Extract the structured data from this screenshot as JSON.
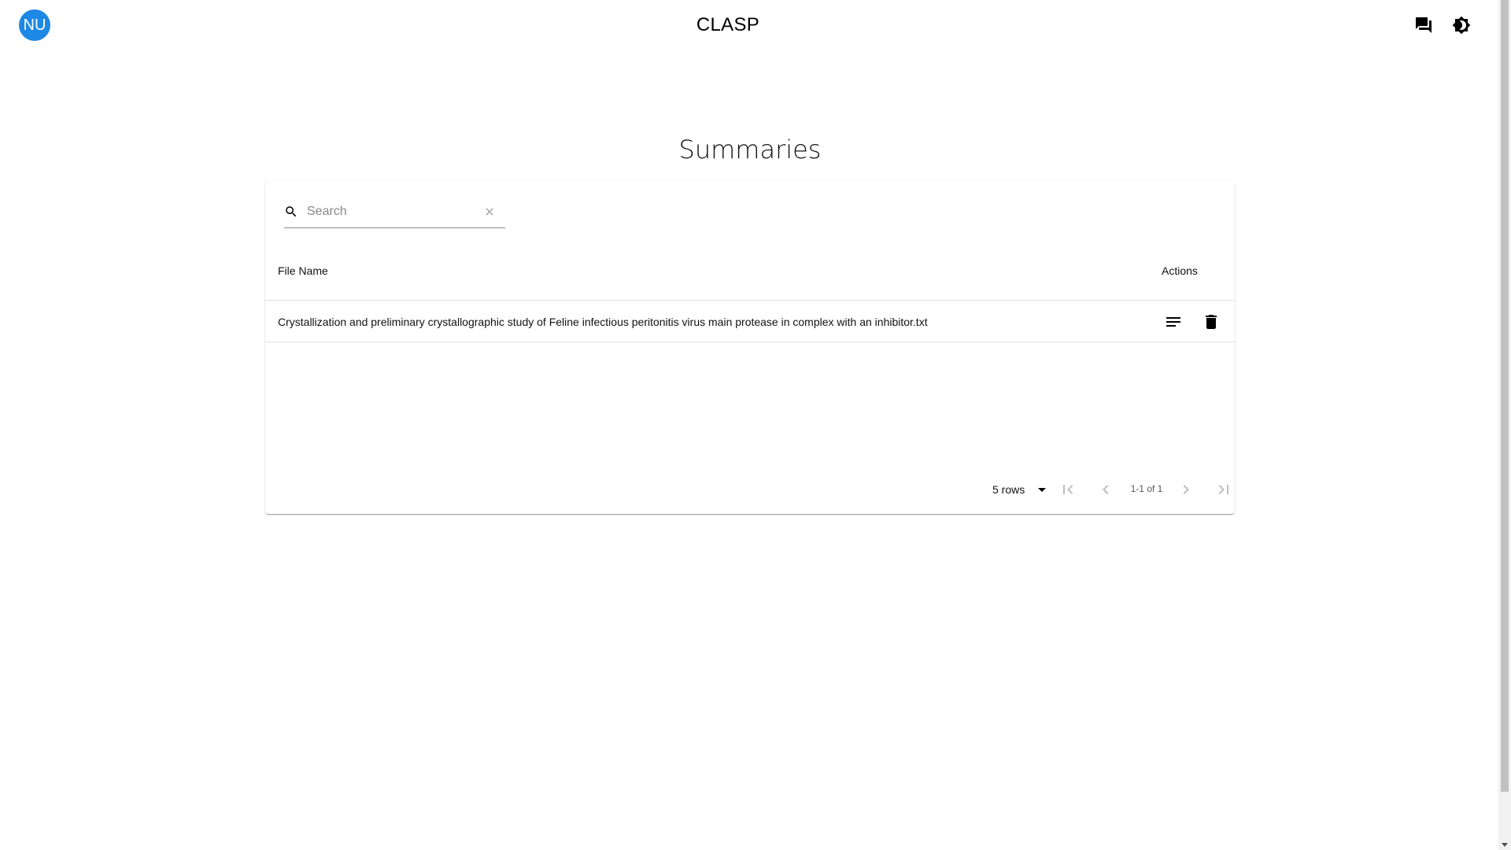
{
  "header": {
    "avatar_initials": "NU",
    "app_title": "CLASP",
    "icons": [
      "chat-icon",
      "theme-toggle-icon"
    ]
  },
  "page": {
    "heading": "Summaries"
  },
  "search": {
    "placeholder": "Search",
    "value": ""
  },
  "table": {
    "columns": [
      "File Name",
      "Actions"
    ],
    "rows": [
      {
        "file_name": "Crystallization and preliminary crystallographic study of Feline infectious peritonitis virus main protease in complex with an inhibitor.txt",
        "actions": [
          "summary-icon",
          "delete-icon"
        ]
      }
    ]
  },
  "pagination": {
    "rows_per_page": "5 rows",
    "range_label": "1-1 of 1"
  },
  "colors": {
    "avatar_bg": "#1e88e5",
    "text": "#000000",
    "divider": "#e0e0e0"
  }
}
